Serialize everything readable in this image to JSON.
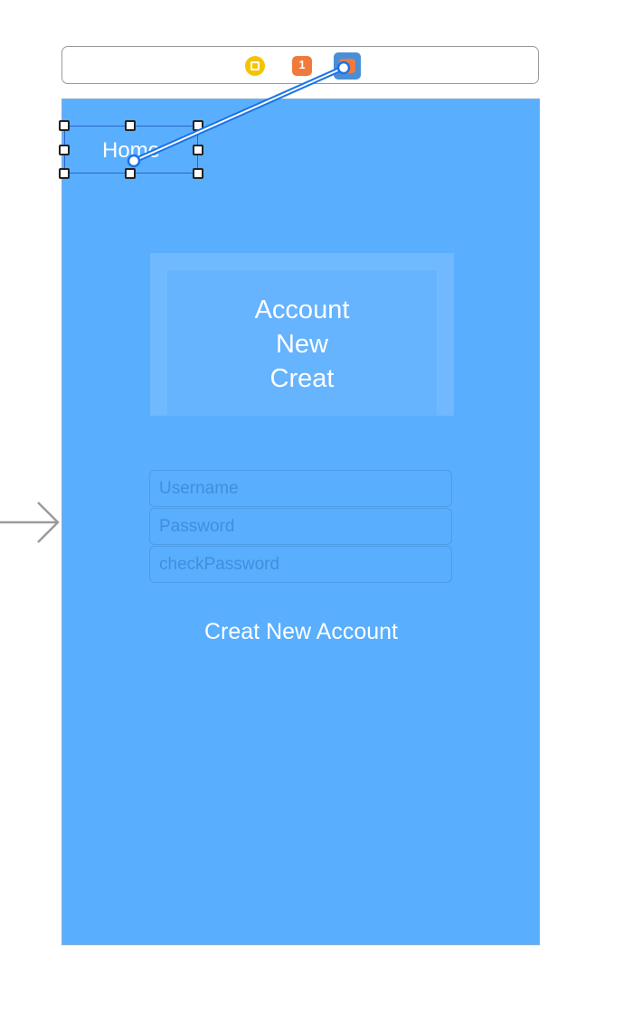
{
  "scene_dock": {
    "icons": [
      "view-controller-icon",
      "first-responder-icon",
      "exit-icon"
    ],
    "colors": {
      "view_controller": "#f5c400",
      "first_responder": "#f07a3c",
      "exit": "#4a8fd6"
    }
  },
  "view": {
    "background": "#59aefe",
    "home_label": "Home",
    "title_lines": [
      "Account",
      "New",
      "Creat"
    ],
    "fields": [
      {
        "placeholder": "Username",
        "value": ""
      },
      {
        "placeholder": "Password",
        "value": ""
      },
      {
        "placeholder": "checkPassword",
        "value": ""
      }
    ],
    "create_button": "Creat New Account"
  },
  "connection": {
    "from": "Home",
    "to": "exit-icon",
    "color": "#1a73e8"
  }
}
